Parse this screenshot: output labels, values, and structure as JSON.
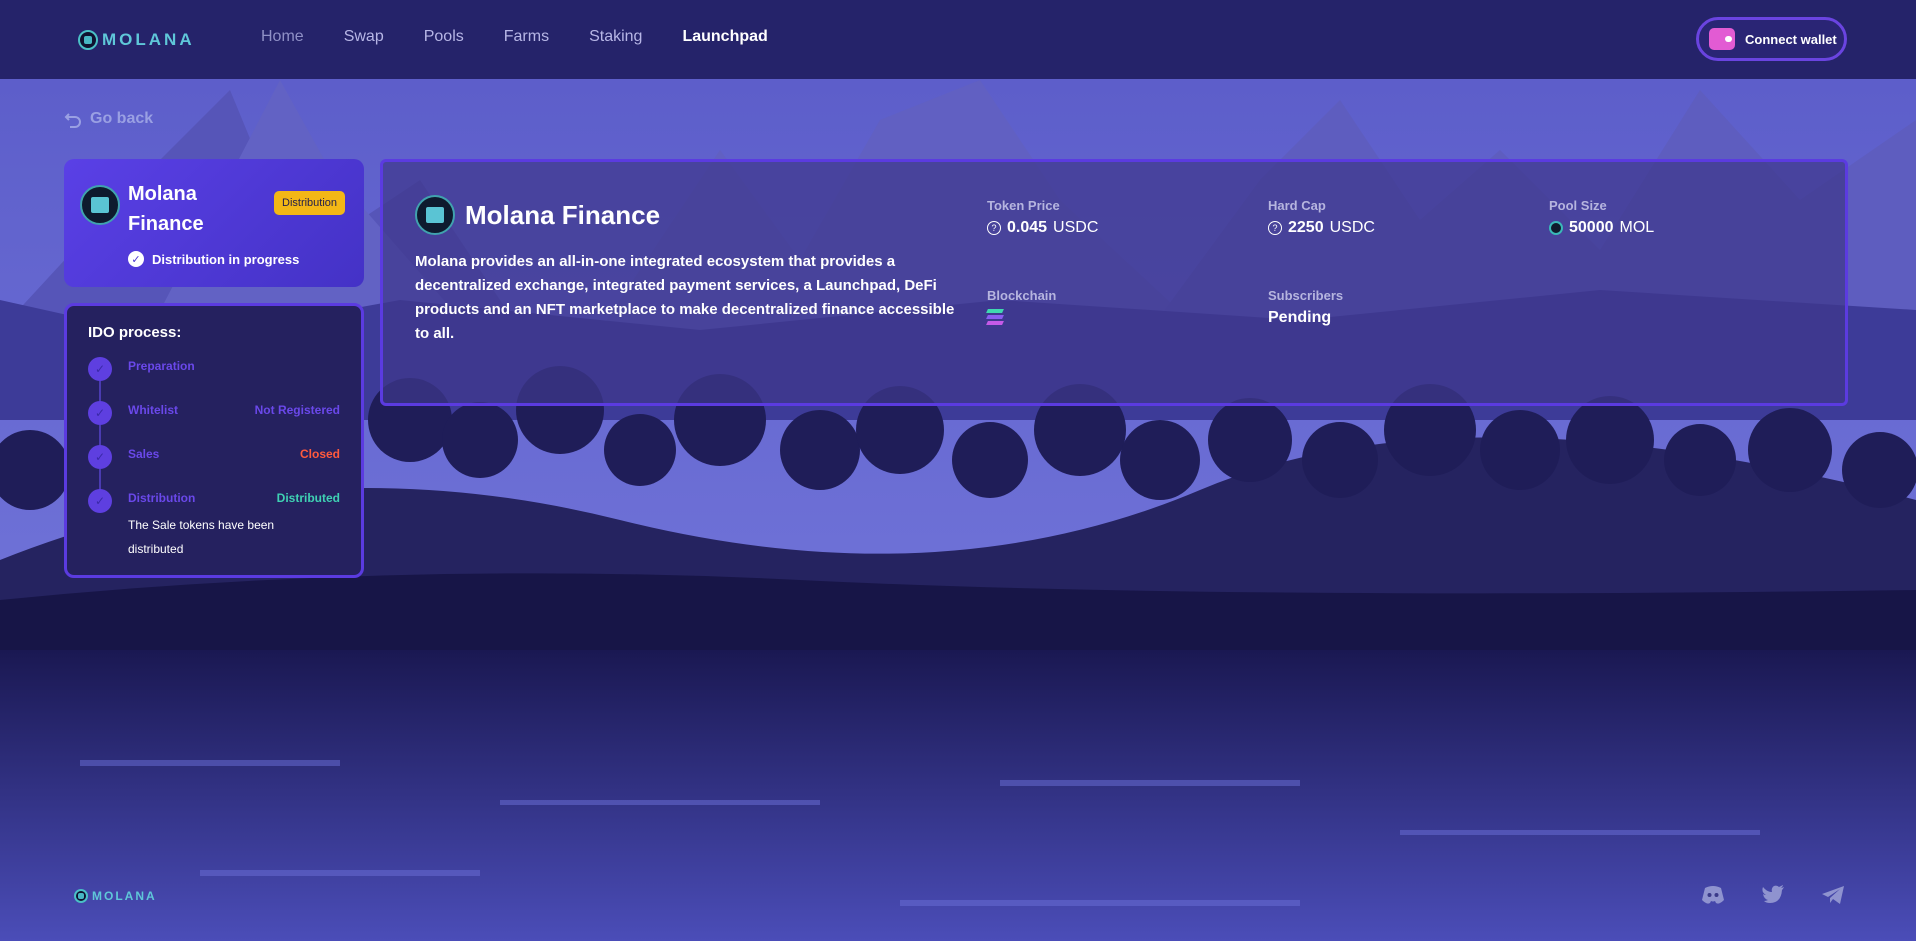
{
  "brand": {
    "name": "MOLANA"
  },
  "nav": {
    "items": [
      {
        "label": "Home"
      },
      {
        "label": "Swap"
      },
      {
        "label": "Pools"
      },
      {
        "label": "Farms"
      },
      {
        "label": "Staking"
      },
      {
        "label": "Launchpad"
      }
    ]
  },
  "header": {
    "connect_label": "Connect wallet"
  },
  "goback": {
    "label": "Go back"
  },
  "status_card": {
    "project_name": "Molana Finance",
    "badge": "Distribution",
    "status_text": "Distribution in progress"
  },
  "ido": {
    "title": "IDO process:",
    "steps": [
      {
        "label": "Preparation",
        "state": ""
      },
      {
        "label": "Whitelist",
        "state": "Not Registered"
      },
      {
        "label": "Sales",
        "state": "Closed"
      },
      {
        "label": "Distribution",
        "state": "Distributed"
      }
    ],
    "note": "The Sale tokens have been distributed"
  },
  "main": {
    "title": "Molana Finance",
    "description": "Molana provides an all-in-one integrated ecosystem that provides a decentralized exchange, integrated payment services, a Launchpad, DeFi products and an NFT marketplace to make decentralized finance accessible to all.",
    "token_price": {
      "label": "Token Price",
      "value": "0.045",
      "unit": "USDC"
    },
    "hard_cap": {
      "label": "Hard Cap",
      "value": "2250",
      "unit": "USDC"
    },
    "pool_size": {
      "label": "Pool Size",
      "value": "50000",
      "unit": "MOL"
    },
    "blockchain": {
      "label": "Blockchain"
    },
    "subscribers": {
      "label": "Subscribers",
      "value": "Pending"
    }
  },
  "colors": {
    "topbar": "#25236a",
    "accent": "#5b3be0",
    "badge": "#f3b716",
    "closed": "#ff5a3d",
    "distributed": "#3fd1b3"
  },
  "icons": {
    "socials": [
      "discord-icon",
      "twitter-icon",
      "telegram-icon"
    ]
  }
}
